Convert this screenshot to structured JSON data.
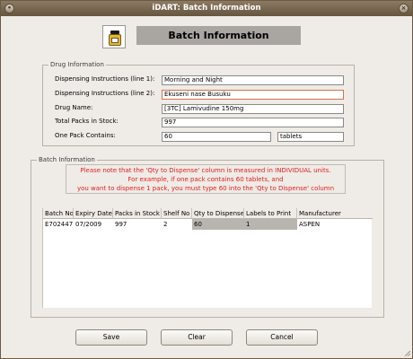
{
  "window": {
    "title": "iDART: Batch Information"
  },
  "header": {
    "title": "Batch Information",
    "icon": "medicine-bottle-icon"
  },
  "drug_info": {
    "legend": "Drug Information",
    "instr1_label": "Dispensing Instructions (line 1):",
    "instr1_value": "Morning and Night",
    "instr2_label": "Dispensing Instructions (line 2):",
    "instr2_value": "Ekuseni nase Busuku",
    "drug_name_label": "Drug Name:",
    "drug_name_value": "[3TC] Lamivudine 150mg",
    "packs_label": "Total Packs in Stock:",
    "packs_value": "997",
    "pack_contains_label": "One Pack Contains:",
    "pack_contains_value": "60",
    "pack_unit": "tablets"
  },
  "batch_info": {
    "legend": "Batch Information",
    "notice": {
      "line1": "Please note that the 'Qty to Dispense' column is measured in INDIVIDUAL units.",
      "line2": "For example, if one pack contains 60 tablets, and",
      "line3": "you want to dispense 1 pack, you must type 60 into the 'Qty to Dispense' column"
    },
    "columns": [
      "Batch No",
      "Expiry Date",
      "Packs in Stock",
      "Shelf No",
      "Qty to Dispense",
      "Labels to Print",
      "Manufacturer"
    ],
    "rows": [
      [
        "E702447",
        "07/2009",
        "997",
        "2",
        "60",
        "1",
        "ASPEN"
      ]
    ]
  },
  "buttons": {
    "save": "Save",
    "clear": "Clear",
    "cancel": "Cancel"
  },
  "colors": {
    "notice_text": "#e02020",
    "titlebar": "#66553f",
    "header_bg": "#a9a6a2"
  }
}
